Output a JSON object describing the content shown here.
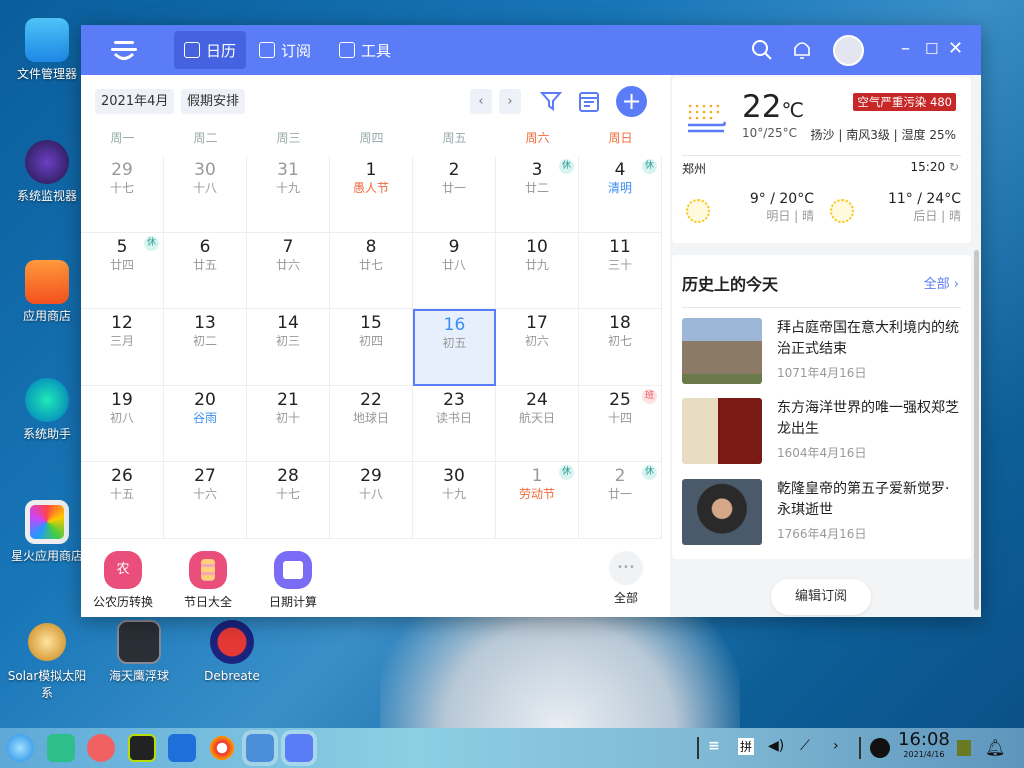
{
  "desktop": {
    "icons": [
      {
        "label": "文件管理器"
      },
      {
        "label": "系统监视器"
      },
      {
        "label": "应用商店"
      },
      {
        "label": "系统助手"
      },
      {
        "label": "星火应用商店"
      },
      {
        "label": "Solar模拟太阳系"
      },
      {
        "label": "海天鹰浮球"
      },
      {
        "label": "Debreate"
      }
    ]
  },
  "header": {
    "tabs": [
      {
        "label": "日历",
        "icon": "calendar-check-icon"
      },
      {
        "label": "订阅",
        "icon": "bookmark-star-icon"
      },
      {
        "label": "工具",
        "icon": "toolbox-icon"
      }
    ]
  },
  "toolbar": {
    "month": "2021年4月",
    "holidays": "假期安排",
    "prev": "‹",
    "next": "›",
    "add": "+"
  },
  "weekdays": [
    "周一",
    "周二",
    "周三",
    "周四",
    "周五",
    "周六",
    "周日"
  ],
  "days": [
    {
      "d": "29",
      "l": "十七",
      "o": 1
    },
    {
      "d": "30",
      "l": "十八",
      "o": 1
    },
    {
      "d": "31",
      "l": "十九",
      "o": 1
    },
    {
      "d": "1",
      "l": "愚人节",
      "c": "fest"
    },
    {
      "d": "2",
      "l": "廿一"
    },
    {
      "d": "3",
      "l": "廿二",
      "b": "休"
    },
    {
      "d": "4",
      "l": "清明",
      "c": "term",
      "b": "休"
    },
    {
      "d": "5",
      "l": "廿四",
      "b": "休"
    },
    {
      "d": "6",
      "l": "廿五"
    },
    {
      "d": "7",
      "l": "廿六"
    },
    {
      "d": "8",
      "l": "廿七"
    },
    {
      "d": "9",
      "l": "廿八"
    },
    {
      "d": "10",
      "l": "廿九"
    },
    {
      "d": "11",
      "l": "三十"
    },
    {
      "d": "12",
      "l": "三月"
    },
    {
      "d": "13",
      "l": "初二"
    },
    {
      "d": "14",
      "l": "初三"
    },
    {
      "d": "15",
      "l": "初四"
    },
    {
      "d": "16",
      "l": "初五",
      "t": 1
    },
    {
      "d": "17",
      "l": "初六"
    },
    {
      "d": "18",
      "l": "初七"
    },
    {
      "d": "19",
      "l": "初八"
    },
    {
      "d": "20",
      "l": "谷雨",
      "c": "term"
    },
    {
      "d": "21",
      "l": "初十"
    },
    {
      "d": "22",
      "l": "地球日"
    },
    {
      "d": "23",
      "l": "读书日"
    },
    {
      "d": "24",
      "l": "航天日"
    },
    {
      "d": "25",
      "l": "十四",
      "b": "班"
    },
    {
      "d": "26",
      "l": "十五"
    },
    {
      "d": "27",
      "l": "十六"
    },
    {
      "d": "28",
      "l": "十七"
    },
    {
      "d": "29",
      "l": "十八"
    },
    {
      "d": "30",
      "l": "十九"
    },
    {
      "d": "1",
      "l": "劳动节",
      "c": "fest",
      "o": 1,
      "b": "休"
    },
    {
      "d": "2",
      "l": "廿一",
      "o": 1,
      "b": "休"
    }
  ],
  "tools": [
    {
      "label": "公农历转换",
      "glyph": "农"
    },
    {
      "label": "节日大全"
    },
    {
      "label": "日期计算"
    },
    {
      "label": "全部",
      "glyph": "•••"
    }
  ],
  "weather": {
    "temp": "22",
    "unit": "℃",
    "range": "10°/25°C",
    "aqi": "空气严重污染 480",
    "detail": "扬沙 | 南风3级 | 湿度 25%",
    "city": "郑州",
    "time": "15:20",
    "forecast": [
      {
        "temp": "9° / 20°C",
        "desc": "明日 | 晴"
      },
      {
        "temp": "11° / 24°C",
        "desc": "后日 | 晴"
      }
    ]
  },
  "history": {
    "title": "历史上的今天",
    "all": "全部",
    "items": [
      {
        "title": "拜占庭帝国在意大利境内的统治正式结束",
        "date": "1071年4月16日"
      },
      {
        "title": "东方海洋世界的唯一强权郑芝龙出生",
        "date": "1604年4月16日"
      },
      {
        "title": "乾隆皇帝的第五子爱新觉罗·永琪逝世",
        "date": "1766年4月16日"
      }
    ],
    "edit": "编辑订阅"
  },
  "taskbar": {
    "ime": "拼",
    "time": "16:08",
    "date": "2021/4/16"
  },
  "colors": {
    "accent": "#5b7cf7",
    "festival": "#f06a3a",
    "term": "#3a8ef0",
    "aqi": "#c62828"
  }
}
